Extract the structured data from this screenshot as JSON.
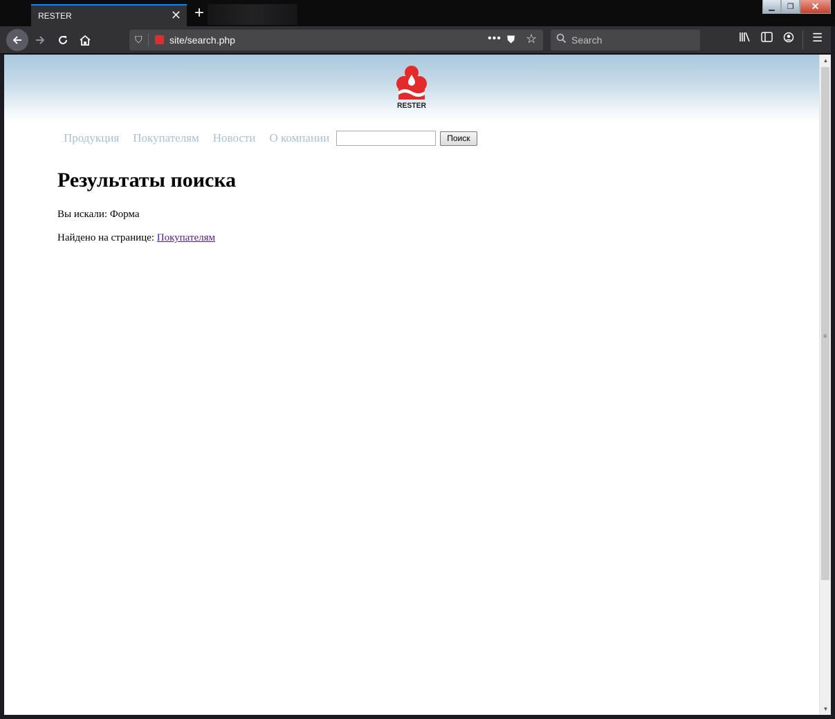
{
  "browser": {
    "tab_title": "RESTER",
    "url": "site/search.php",
    "search_placeholder": "Search",
    "new_tab_label": "+",
    "close_label": "✕",
    "icons": [
      "back-icon",
      "forward-icon",
      "reload-icon",
      "home-icon",
      "shield-icon",
      "page-actions-icon",
      "pocket-icon",
      "bookmark-star-icon",
      "search-icon",
      "library-icon",
      "sidebar-icon",
      "account-icon",
      "menu-icon"
    ]
  },
  "site": {
    "logo_text": "RESTER",
    "brand_color": "#e32b2b",
    "nav": {
      "items": [
        "Продукция",
        "Покупателям",
        "Новости",
        "О компании"
      ],
      "search_value": "",
      "search_button": "Поиск"
    },
    "results": {
      "title": "Результаты поиска",
      "query_label": "Вы искали:",
      "query_value": "Форма",
      "found_label": "Найдено на странице:",
      "found_link": "Покупателям"
    }
  }
}
